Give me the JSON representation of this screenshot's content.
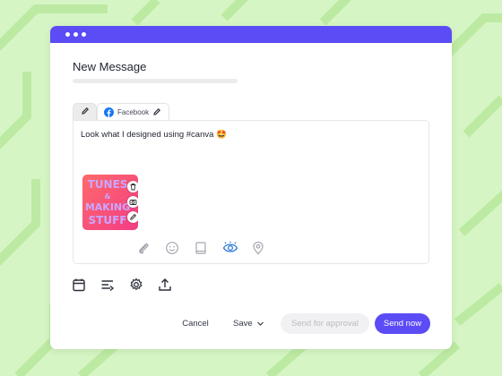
{
  "dialog": {
    "title": "New Message"
  },
  "tabs": {
    "facebook_label": "Facebook"
  },
  "editor": {
    "message": "Look what I designed using #canva 🤩",
    "image_text_lines": [
      "TUNES",
      "&",
      "MAKING",
      "STUFF"
    ]
  },
  "actions": {
    "cancel": "Cancel",
    "save": "Save",
    "approval": "Send for approval",
    "send_now": "Send now"
  },
  "colors": {
    "background": "#d6f5c4",
    "accent": "#5b4cf5",
    "facebook": "#1877f2"
  }
}
